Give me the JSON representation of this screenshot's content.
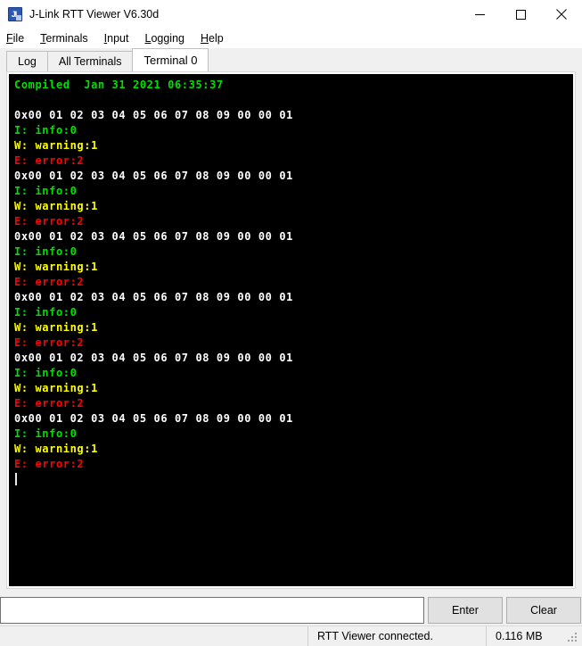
{
  "window": {
    "title": "J-Link RTT Viewer V6.30d",
    "icon": "jlink-app-icon",
    "controls": {
      "minimize": "minimize-icon",
      "maximize": "maximize-icon",
      "close": "close-icon"
    }
  },
  "menubar": {
    "items": [
      {
        "mnemonic": "F",
        "rest": "ile"
      },
      {
        "mnemonic": "T",
        "rest": "erminals"
      },
      {
        "mnemonic": "I",
        "rest": "nput"
      },
      {
        "mnemonic": "L",
        "rest": "ogging"
      },
      {
        "mnemonic": "H",
        "rest": "elp"
      }
    ]
  },
  "tabs": {
    "items": [
      {
        "label": "Log",
        "active": false
      },
      {
        "label": "All Terminals",
        "active": false
      },
      {
        "label": "Terminal 0",
        "active": true
      }
    ],
    "selected": "Terminal 0"
  },
  "terminal": {
    "background": "#000000",
    "colors": {
      "green": "#00e000",
      "white": "#ffffff",
      "yellow": "#ffff00",
      "red": "#ff0000",
      "cursor": "#e8e8e8"
    },
    "lines": [
      {
        "text": "Compiled  Jan 31 2021 06:35:37",
        "color": "#00e000"
      },
      {
        "text": "",
        "color": "#00e000"
      },
      {
        "text": "0x00 01 02 03 04 05 06 07 08 09 00 00 01",
        "color": "#ffffff"
      },
      {
        "text": "I: info:0",
        "color": "#00e000"
      },
      {
        "text": "W: warning:1",
        "color": "#ffff00"
      },
      {
        "text": "E: error:2",
        "color": "#ff0000"
      },
      {
        "text": "0x00 01 02 03 04 05 06 07 08 09 00 00 01",
        "color": "#ffffff"
      },
      {
        "text": "I: info:0",
        "color": "#00e000"
      },
      {
        "text": "W: warning:1",
        "color": "#ffff00"
      },
      {
        "text": "E: error:2",
        "color": "#ff0000"
      },
      {
        "text": "0x00 01 02 03 04 05 06 07 08 09 00 00 01",
        "color": "#ffffff"
      },
      {
        "text": "I: info:0",
        "color": "#00e000"
      },
      {
        "text": "W: warning:1",
        "color": "#ffff00"
      },
      {
        "text": "E: error:2",
        "color": "#ff0000"
      },
      {
        "text": "0x00 01 02 03 04 05 06 07 08 09 00 00 01",
        "color": "#ffffff"
      },
      {
        "text": "I: info:0",
        "color": "#00e000"
      },
      {
        "text": "W: warning:1",
        "color": "#ffff00"
      },
      {
        "text": "E: error:2",
        "color": "#ff0000"
      },
      {
        "text": "0x00 01 02 03 04 05 06 07 08 09 00 00 01",
        "color": "#ffffff"
      },
      {
        "text": "I: info:0",
        "color": "#00e000"
      },
      {
        "text": "W: warning:1",
        "color": "#ffff00"
      },
      {
        "text": "E: error:2",
        "color": "#ff0000"
      },
      {
        "text": "0x00 01 02 03 04 05 06 07 08 09 00 00 01",
        "color": "#ffffff"
      },
      {
        "text": "I: info:0",
        "color": "#00e000"
      },
      {
        "text": "W: warning:1",
        "color": "#ffff00"
      },
      {
        "text": "E: error:2",
        "color": "#ff0000"
      }
    ],
    "cursor_visible": true
  },
  "input_row": {
    "command_value": "",
    "command_placeholder": "",
    "enter_label": "Enter",
    "clear_label": "Clear"
  },
  "statusbar": {
    "connection": "RTT Viewer connected.",
    "data_size": "0.116 MB",
    "grip": "resize-grip-icon"
  }
}
